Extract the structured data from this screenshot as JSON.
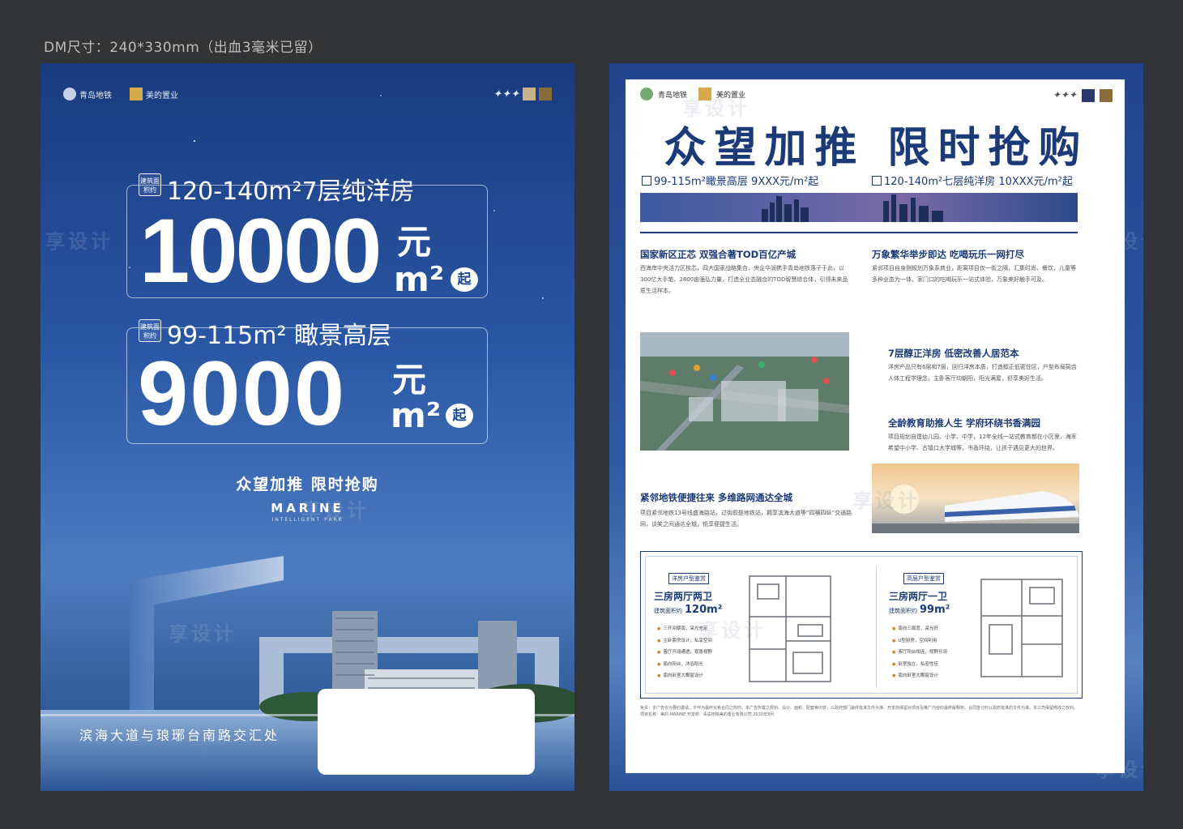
{
  "spec_label": "DM尺寸：240*330mm（出血3毫米已留）",
  "watermark": "享设计",
  "left": {
    "logos": [
      "青岛地铁",
      "美的置业"
    ],
    "tag": "建筑面积约",
    "line1": {
      "area": "120-140m²7层纯洋房",
      "price": "10000",
      "unit_top": "元",
      "unit_bottom": "m²",
      "from": "起"
    },
    "line2": {
      "area": "99-115m² 瞰景高层",
      "price": "9000",
      "unit_top": "元",
      "unit_bottom": "m²",
      "from": "起"
    },
    "slogan": "众望加推 限时抢购",
    "brand": "MARINE",
    "brand_sub": "INTELLIGENT PARK",
    "address": "滨海大道与琅琊台南路交汇处"
  },
  "right": {
    "headline": "众望加推 限时抢购",
    "price_a": "99-115m²瞰景高层 9XXX元/m²起",
    "price_b": "120-140m²七层纯洋房 10XXX元/m²起",
    "sections": [
      {
        "title": "国家新区正芯 双强合著TOD百亿产城",
        "body": "西海岸中央活力区核芯，四大国家战略集合，央企华润携手青岛地铁落子于此，以300亿大手笔、2800亩强弘力量，打造全业态融合的TOD智慧综合体，引领未来品质生活样本。"
      },
      {
        "title": "万象繁华举步即达 吃喝玩乐一网打尽",
        "body": "紧邻项目自身侧规划万象系商业，距离项目仅一街之隔，汇集时尚、餐饮、儿童等多种业态为一体，家门口的吃喝玩乐一站式体验，万象美好触手可及。"
      },
      {
        "title": "7层醇正洋房 低密改善人居范本",
        "body": "洋房产品只有6层和7层，回归洋房本质，打造醇正低密住区，户型布局契合人体工程学理念，主卧客厅均朝阳，阳光满屋，舒享美好生活。"
      },
      {
        "title": "全龄教育助推人生 学府环绕书香满园",
        "body": "项目规划自建幼儿园、小学、中学，12年全线一站式教育都在小区里，海军希望中小学、古镇口大学城等，书香环绕，让孩子遇见更大的世界。"
      },
      {
        "title": "紧邻地铁便捷往来 多维路网通达全城",
        "body": "项目紧邻地铁13号线盛海路站，过街即是地铁站，拥享滨海大道等“四横四纵”交通路网，谈笑之间通达全城，悦享便捷生活。"
      }
    ],
    "plans": [
      {
        "tag": "洋房户型鉴赏",
        "title": "三房两厅两卫",
        "area_label": "建筑面积约",
        "area": "120m²",
        "features": [
          "三开间朝南，采光充足",
          "主卧套房设计，私享空间",
          "客厅开阔通透，观景视野",
          "南向阳台，沐浴阳光",
          "南向卧室大飘窗设计"
        ]
      },
      {
        "tag": "高层户型鉴赏",
        "title": "三房两厅一卫",
        "area_label": "建筑面积约",
        "area": "99m²",
        "features": [
          "南向三面宽，采光好",
          "U型厨房，空间利用",
          "客厅阳台相连，视野开阔",
          "卧室独立，私密性佳",
          "南向卧室大飘窗设计"
        ]
      }
    ],
    "disclaimer": "免责：本广告仅为要约邀请，不作为最终买卖合同之附件。本广告所载之规划、设计、面积、配套等内容，以政府部门最终批准文件为准。开发商保留对项目及推广内容的最终解释权。合同签订时以政府批准的文件为准，本公司保留修改之权利。项目名称：美的·MARINE 开发商：青岛地铁美的置业有限公司 2020年8月"
  },
  "colors": {
    "navy": "#1b3a78",
    "accent": "#c98a2c"
  }
}
